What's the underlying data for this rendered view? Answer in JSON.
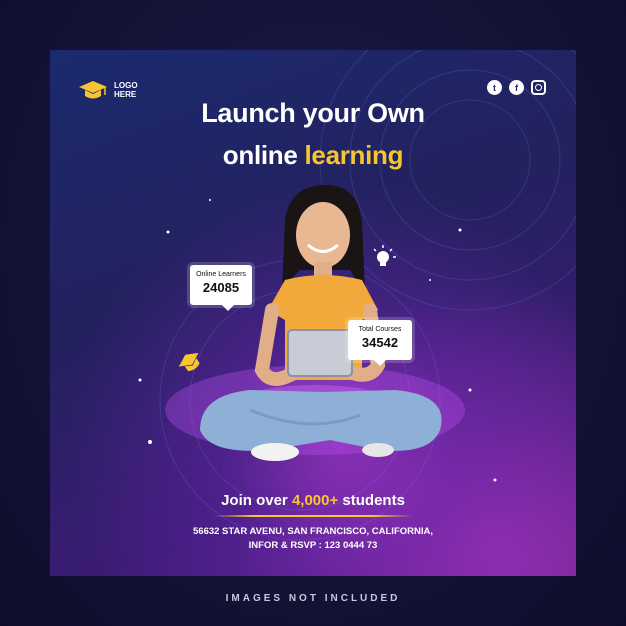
{
  "logo": {
    "text_line1": "LOGO",
    "text_line2": "HERE"
  },
  "socials": [
    {
      "icon": "twitter-icon",
      "glyph": "t"
    },
    {
      "icon": "facebook-icon",
      "glyph": "f"
    },
    {
      "icon": "instagram-icon"
    }
  ],
  "headline": "Launch your Own",
  "subline": {
    "white": "online",
    "yellow": "learning"
  },
  "stats": [
    {
      "label": "Online Learners",
      "value": "24085"
    },
    {
      "label": "Total Courses",
      "value": "34542"
    }
  ],
  "cta": {
    "prefix": "Join over ",
    "highlight": "4,000+",
    "suffix": " students"
  },
  "address": {
    "line1": "56632 STAR AVENU, SAN FRANCISCO, CALIFORNIA,",
    "line2": "INFOR & RSVP  : 123 0444 73"
  },
  "footer": "IMAGES NOT INCLUDED",
  "colors": {
    "accent_yellow": "#f7c531",
    "background": "#15133a",
    "card_purple": "#5a1f85"
  }
}
